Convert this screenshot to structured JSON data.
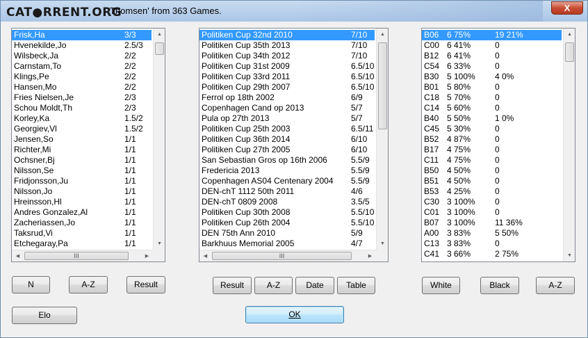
{
  "window": {
    "logo_text": "CAT●RRENT.ORG",
    "title": "Thomsen' from 363 Games.",
    "close_label": "X"
  },
  "players": {
    "rows": [
      {
        "name": "Frisk,Ha",
        "score": "3/3"
      },
      {
        "name": "Hvenekilde,Jo",
        "score": "2.5/3"
      },
      {
        "name": "Wilsbeck,Ja",
        "score": "2/2"
      },
      {
        "name": "Carnstam,To",
        "score": "2/2"
      },
      {
        "name": "Klings,Pe",
        "score": "2/2"
      },
      {
        "name": "Hansen,Mo",
        "score": "2/2"
      },
      {
        "name": "Fries Nielsen,Je",
        "score": "2/3"
      },
      {
        "name": "Schou Moldt,Th",
        "score": "2/3"
      },
      {
        "name": "Korley,Ka",
        "score": "1.5/2"
      },
      {
        "name": "Georgiev,Vl",
        "score": "1.5/2"
      },
      {
        "name": "Jensen,So",
        "score": "1/1"
      },
      {
        "name": "Richter,Mi",
        "score": "1/1"
      },
      {
        "name": "Ochsner,Bj",
        "score": "1/1"
      },
      {
        "name": "Nilsson,Se",
        "score": "1/1"
      },
      {
        "name": "Fridjonsson,Ju",
        "score": "1/1"
      },
      {
        "name": "Nilsson,Jo",
        "score": "1/1"
      },
      {
        "name": "Hreinsson,Hl",
        "score": "1/1"
      },
      {
        "name": "Andres Gonzalez,Al",
        "score": "1/1"
      },
      {
        "name": "Zacheriassen,Jo",
        "score": "1/1"
      },
      {
        "name": "Taksrud,Vi",
        "score": "1/1"
      },
      {
        "name": "Etchegaray,Pa",
        "score": "1/1"
      }
    ],
    "buttons": {
      "n": "N",
      "az": "A-Z",
      "result": "Result",
      "elo": "Elo"
    }
  },
  "tournaments": {
    "rows": [
      {
        "name": "Politiken Cup 32nd 2010",
        "score": "7/10"
      },
      {
        "name": "Politiken Cup 35th 2013",
        "score": "7/10"
      },
      {
        "name": "Politiken Cup 34th 2012",
        "score": "7/10"
      },
      {
        "name": "Politiken Cup 31st 2009",
        "score": "6.5/10"
      },
      {
        "name": "Politiken Cup 33rd 2011",
        "score": "6.5/10"
      },
      {
        "name": "Politiken Cup 29th 2007",
        "score": "6.5/10"
      },
      {
        "name": "Ferrol op 18th 2002",
        "score": "6/9"
      },
      {
        "name": "Copenhagen Cand op 2013",
        "score": "5/7"
      },
      {
        "name": "Pula op 27th 2013",
        "score": "5/7"
      },
      {
        "name": "Politiken Cup 25th 2003",
        "score": "6.5/11"
      },
      {
        "name": "Politiken Cup 36th 2014",
        "score": "6/10"
      },
      {
        "name": "Politiken Cup 27th 2005",
        "score": "6/10"
      },
      {
        "name": "San Sebastian Gros op 16th 2006",
        "score": "5.5/9"
      },
      {
        "name": "Fredericia 2013",
        "score": "5.5/9"
      },
      {
        "name": "Copenhagen AS04 Centenary 2004",
        "score": "5.5/9"
      },
      {
        "name": "DEN-chT 1112 50th 2011",
        "score": "4/6"
      },
      {
        "name": "DEN-chT 0809 2008",
        "score": "3.5/5"
      },
      {
        "name": "Politiken Cup 30th 2008",
        "score": "5.5/10"
      },
      {
        "name": "Politiken Cup 26th 2004",
        "score": "5.5/10"
      },
      {
        "name": "DEN 75th Ann 2010",
        "score": "5/9"
      },
      {
        "name": "Barkhuus Memorial 2005",
        "score": "4/7"
      }
    ],
    "buttons": {
      "result": "Result",
      "az": "A-Z",
      "date": "Date",
      "table": "Table"
    }
  },
  "openings": {
    "rows": [
      {
        "eco": "B06",
        "c1": "6 75%",
        "c2": "19 21%"
      },
      {
        "eco": "C00",
        "c1": "6 41%",
        "c2": "0"
      },
      {
        "eco": "B12",
        "c1": "6 41%",
        "c2": "0"
      },
      {
        "eco": "C54",
        "c1": "6 33%",
        "c2": "0"
      },
      {
        "eco": "B30",
        "c1": "5 100%",
        "c2": "4 0%"
      },
      {
        "eco": "B01",
        "c1": "5 80%",
        "c2": "0"
      },
      {
        "eco": "C18",
        "c1": "5 70%",
        "c2": "0"
      },
      {
        "eco": "C14",
        "c1": "5 60%",
        "c2": "0"
      },
      {
        "eco": "B40",
        "c1": "5 50%",
        "c2": "1 0%"
      },
      {
        "eco": "C45",
        "c1": "5 30%",
        "c2": "0"
      },
      {
        "eco": "B52",
        "c1": "4 87%",
        "c2": "0"
      },
      {
        "eco": "B17",
        "c1": "4 75%",
        "c2": "0"
      },
      {
        "eco": "C11",
        "c1": "4 75%",
        "c2": "0"
      },
      {
        "eco": "B50",
        "c1": "4 50%",
        "c2": "0"
      },
      {
        "eco": "B51",
        "c1": "4 50%",
        "c2": "0"
      },
      {
        "eco": "B53",
        "c1": "4 25%",
        "c2": "0"
      },
      {
        "eco": "C30",
        "c1": "3 100%",
        "c2": "0"
      },
      {
        "eco": "C01",
        "c1": "3 100%",
        "c2": "0"
      },
      {
        "eco": "B07",
        "c1": "3 100%",
        "c2": "11 36%"
      },
      {
        "eco": "A00",
        "c1": "3 83%",
        "c2": "5 50%"
      },
      {
        "eco": "C13",
        "c1": "3 83%",
        "c2": "0"
      },
      {
        "eco": "C41",
        "c1": "3 66%",
        "c2": "2 75%"
      }
    ],
    "buttons": {
      "white": "White",
      "black": "Black",
      "az": "A-Z"
    }
  },
  "ok_label": "OK",
  "scroll": {
    "thumb_grip": "III",
    "up": "▲",
    "down": "▼",
    "left": "◀",
    "right": "▶"
  },
  "colors": {
    "selection": "#3399ff",
    "close": "#c74c33"
  }
}
